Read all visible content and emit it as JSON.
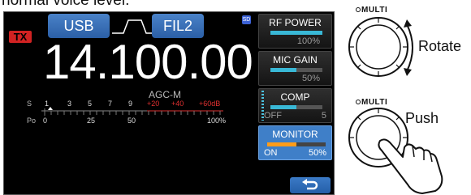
{
  "caption": "normal voice level.",
  "screen": {
    "tx_badge": "TX",
    "mode": "USB",
    "filter": "FIL2",
    "sd_icon_label": "SD",
    "frequency": "14.100.00",
    "agc": "AGC-M",
    "meter": {
      "s_label": "S",
      "s_ticks": [
        "1",
        "3",
        "5",
        "7",
        "9",
        "+20",
        "+40",
        "+60dB"
      ],
      "po_label": "Po",
      "po_ticks": [
        "0",
        "25",
        "50",
        "100%"
      ]
    }
  },
  "side_menu": {
    "rf_power": {
      "label": "RF POWER",
      "value": "100%",
      "level": 1.0
    },
    "mic_gain": {
      "label": "MIC GAIN",
      "value": "50%",
      "level": 0.5
    },
    "comp": {
      "label": "COMP",
      "state": "OFF",
      "value": "5",
      "level": 0.5
    },
    "monitor": {
      "label": "MONITOR",
      "state": "ON",
      "value": "50%",
      "level": 0.5
    },
    "back_icon": "return-arrow-icon"
  },
  "controls": {
    "multi_label": "MULTI",
    "rotate_label": "Rotate",
    "push_label": "Push"
  },
  "colors": {
    "accent_blue": "#3f7fc8",
    "level_cyan": "#39b8d6",
    "monitor_orange": "#ff9c1a",
    "tx_red": "#d12222",
    "meter_red": "#e03030"
  }
}
